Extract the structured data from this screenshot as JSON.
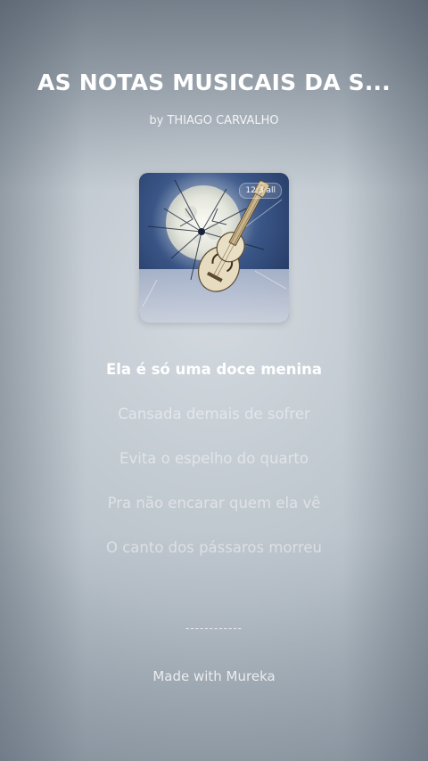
{
  "song": {
    "title": "AS NOTAS MUSICAIS DA S...",
    "artist": "by THIAGO CARVALHO"
  },
  "cover": {
    "icon": "album-cover-moon-guitar-image",
    "status_text": "12:3 all"
  },
  "lyrics": [
    {
      "text": "Ela é só uma doce menina",
      "active": true
    },
    {
      "text": "Cansada demais de sofrer",
      "active": false
    },
    {
      "text": "Evita o espelho do quarto",
      "active": false
    },
    {
      "text": "Pra não encarar quem ela vê",
      "active": false
    },
    {
      "text": "O canto dos pássaros morreu",
      "active": false
    }
  ],
  "divider": "------------",
  "footer": "Made with Mureka",
  "colors": {
    "active_lyric": "#ffffff",
    "inactive_lyric": "rgba(255,255,255,0.48)"
  }
}
